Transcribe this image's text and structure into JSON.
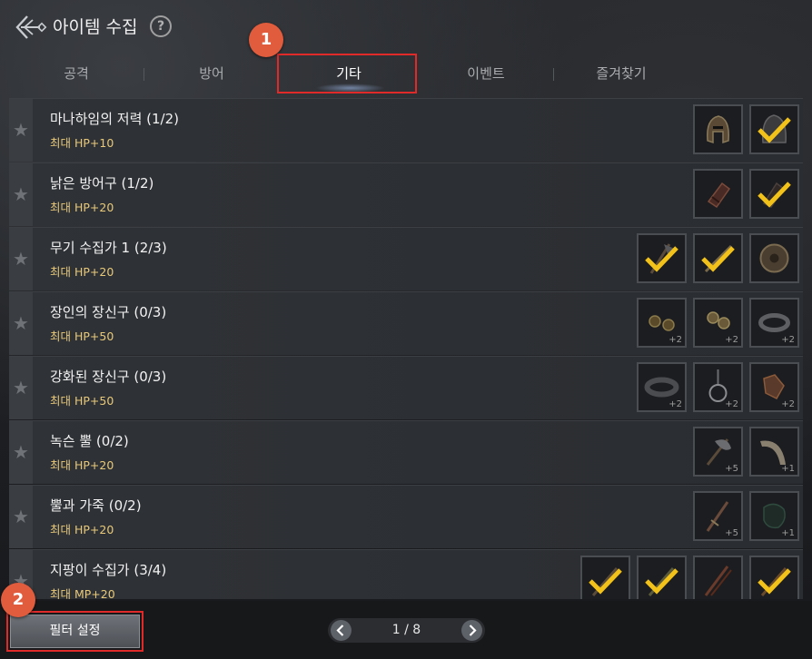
{
  "header": {
    "title": "아이템 수집",
    "help": "?"
  },
  "tabs": [
    {
      "label": "공격",
      "active": false
    },
    {
      "label": "방어",
      "active": false
    },
    {
      "label": "기타",
      "active": true
    },
    {
      "label": "이벤트",
      "active": false
    },
    {
      "label": "즐겨찾기",
      "active": false
    }
  ],
  "badges": {
    "one": "1",
    "two": "2"
  },
  "rows": [
    {
      "name": "마나하임의 저력 (1/2)",
      "stat": "최대 HP+10"
    },
    {
      "name": "낡은 방어구 (1/2)",
      "stat": "최대 HP+20"
    },
    {
      "name": "무기 수집가 1 (2/3)",
      "stat": "최대 HP+20"
    },
    {
      "name": "장인의 장신구 (0/3)",
      "stat": "최대 HP+50"
    },
    {
      "name": "강화된 장신구 (0/3)",
      "stat": "최대 HP+50"
    },
    {
      "name": "녹슨 뿔 (0/2)",
      "stat": "최대 HP+20"
    },
    {
      "name": "뿔과 가죽 (0/2)",
      "stat": "최대 HP+20"
    },
    {
      "name": "지팡이 수집가 (3/4)",
      "stat": "최대 MP+20"
    }
  ],
  "slots": {
    "r3": [
      "+2",
      "+2",
      "+2"
    ],
    "r4": [
      "+2",
      "+2",
      "+2"
    ],
    "r5": [
      "+5",
      "+1"
    ],
    "r6": [
      "+5",
      "+1"
    ]
  },
  "footer": {
    "filter_label": "필터 설정",
    "page_indicator": "1 / 8"
  }
}
